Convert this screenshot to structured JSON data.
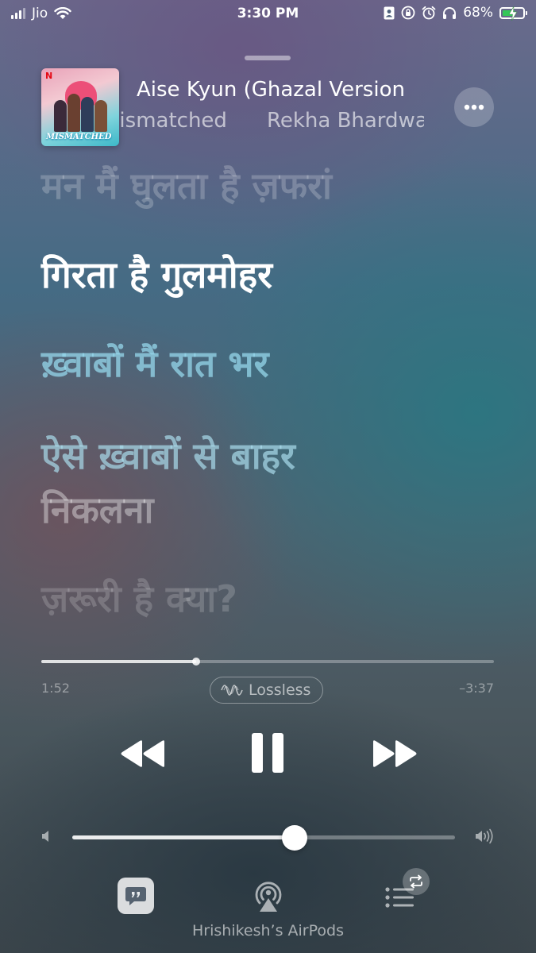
{
  "status_bar": {
    "carrier": "Jio",
    "time": "3:30 PM",
    "battery": "68%",
    "battery_level": 0.68,
    "icons": [
      "signal-bars-icon",
      "wifi-icon",
      "contact-card-icon",
      "orientation-lock-icon",
      "alarm-icon",
      "headphones-icon",
      "battery-charging-icon"
    ]
  },
  "now_playing": {
    "title": "Aise Kyun (Ghazal Version",
    "album": "Mismatched",
    "artist": "Rekha Bhardwaj",
    "artwork_text": "MISMATCHED",
    "artwork_brand": "N"
  },
  "lyrics": {
    "previous": "मन मैं घुलता है ज़फरां",
    "current": "गिरता है गुलमोहर",
    "next_1": "ख़्वाबों मैं रात भर",
    "next_2_line1": "ऐसे ख़्वाबों से बाहर",
    "next_2_line2": "निकलना",
    "next_3": "ज़रूरी है क्या?"
  },
  "playback": {
    "elapsed": "1:52",
    "remaining": "–3:37",
    "progress_fraction": 0.342,
    "quality_badge": "Lossless"
  },
  "volume": {
    "level_fraction": 0.58
  },
  "bottom_bar": {
    "output_device": "Hrishikesh’s AirPods"
  },
  "colors": {
    "battery_fill": "#34c759",
    "current_lyric": "#ffffff"
  }
}
